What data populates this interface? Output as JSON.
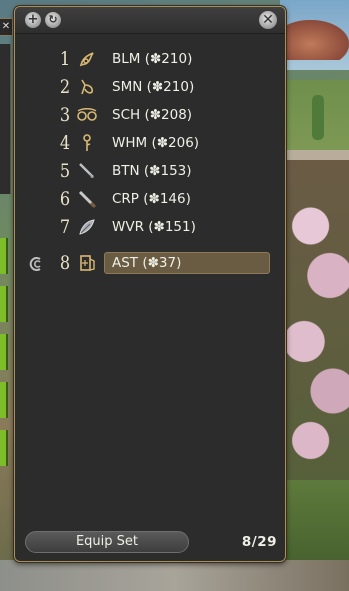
{
  "window": {
    "add_icon": "plus-icon",
    "refresh_icon": "refresh-icon",
    "close_icon": "close-icon"
  },
  "gearsets": [
    {
      "number": "1",
      "job": "BLM",
      "level_text": "BLM (✽210)",
      "icon": "blm-job-icon"
    },
    {
      "number": "2",
      "job": "SMN",
      "level_text": "SMN (✽210)",
      "icon": "smn-job-icon"
    },
    {
      "number": "3",
      "job": "SCH",
      "level_text": "SCH (✽208)",
      "icon": "sch-job-icon"
    },
    {
      "number": "4",
      "job": "WHM",
      "level_text": "WHM (✽206)",
      "icon": "whm-job-icon"
    },
    {
      "number": "5",
      "job": "BTN",
      "level_text": "BTN (✽153)",
      "icon": "btn-job-icon"
    },
    {
      "number": "6",
      "job": "CRP",
      "level_text": "CRP (✽146)",
      "icon": "crp-job-icon"
    },
    {
      "number": "7",
      "job": "WVR",
      "level_text": "WVR (✽151)",
      "icon": "wvr-job-icon"
    },
    {
      "number": "8",
      "job": "AST",
      "level_text": "AST (✽37)",
      "icon": "ast-job-icon",
      "selected": true
    }
  ],
  "footer": {
    "equip_label": "Equip Set",
    "count_text": "8/29"
  },
  "colors": {
    "frame_gold": "#a88f5e",
    "panel_bg": "#2c2c2c",
    "selected_bg": "#6a5c42",
    "text": "#efefe6",
    "icon_gold": "#d8b874"
  }
}
